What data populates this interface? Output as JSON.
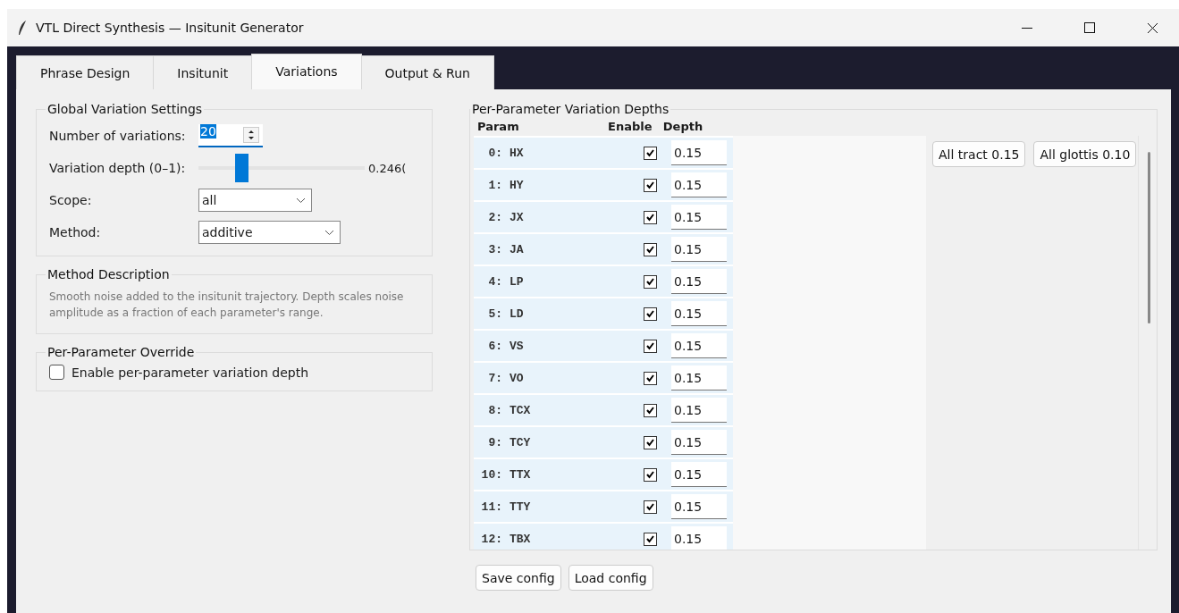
{
  "window": {
    "title": "VTL Direct Synthesis — Insitunit Generator"
  },
  "tabs": [
    {
      "label": "Phrase Design",
      "selected": false
    },
    {
      "label": "Insitunit",
      "selected": false
    },
    {
      "label": "Variations",
      "selected": true
    },
    {
      "label": "Output & Run",
      "selected": false
    }
  ],
  "global_settings": {
    "title": "Global Variation Settings",
    "count_label": "Number of variations:",
    "count_value": "20",
    "depth_label": "Variation depth (0–1):",
    "depth_slider": {
      "level": 0.26
    },
    "depth_reading": "0.246(",
    "scope_label": "Scope:",
    "scope_value": "all",
    "method_label": "Method:",
    "method_value": "additive"
  },
  "method_description": {
    "title": "Method Description",
    "text": "Smooth noise added to the insitunit trajectory. Depth scales noise amplitude as a fraction of each parameter's range."
  },
  "override": {
    "title": "Per-Parameter Override",
    "label": "Enable per-parameter variation depth",
    "checked": false
  },
  "depths": {
    "title": "Per-Parameter Variation Depths",
    "columns": [
      "Param",
      "Enable",
      "Depth"
    ],
    "rows": [
      {
        "index": "0:",
        "name": "HX",
        "enabled": true,
        "depth": "0.15"
      },
      {
        "index": "1:",
        "name": "HY",
        "enabled": true,
        "depth": "0.15"
      },
      {
        "index": "2:",
        "name": "JX",
        "enabled": true,
        "depth": "0.15"
      },
      {
        "index": "3:",
        "name": "JA",
        "enabled": true,
        "depth": "0.15"
      },
      {
        "index": "4:",
        "name": "LP",
        "enabled": true,
        "depth": "0.15"
      },
      {
        "index": "5:",
        "name": "LD",
        "enabled": true,
        "depth": "0.15"
      },
      {
        "index": "6:",
        "name": "VS",
        "enabled": true,
        "depth": "0.15"
      },
      {
        "index": "7:",
        "name": "VO",
        "enabled": true,
        "depth": "0.15"
      },
      {
        "index": "8:",
        "name": "TCX",
        "enabled": true,
        "depth": "0.15"
      },
      {
        "index": "9:",
        "name": "TCY",
        "enabled": true,
        "depth": "0.15"
      },
      {
        "index": "10:",
        "name": "TTX",
        "enabled": true,
        "depth": "0.15"
      },
      {
        "index": "11:",
        "name": "TTY",
        "enabled": true,
        "depth": "0.15"
      },
      {
        "index": "12:",
        "name": "TBX",
        "enabled": true,
        "depth": "0.15"
      }
    ],
    "presets": [
      "All tract 0.15",
      "All glottis 0.10"
    ]
  },
  "buttons": [
    "Save config",
    "Load config"
  ]
}
